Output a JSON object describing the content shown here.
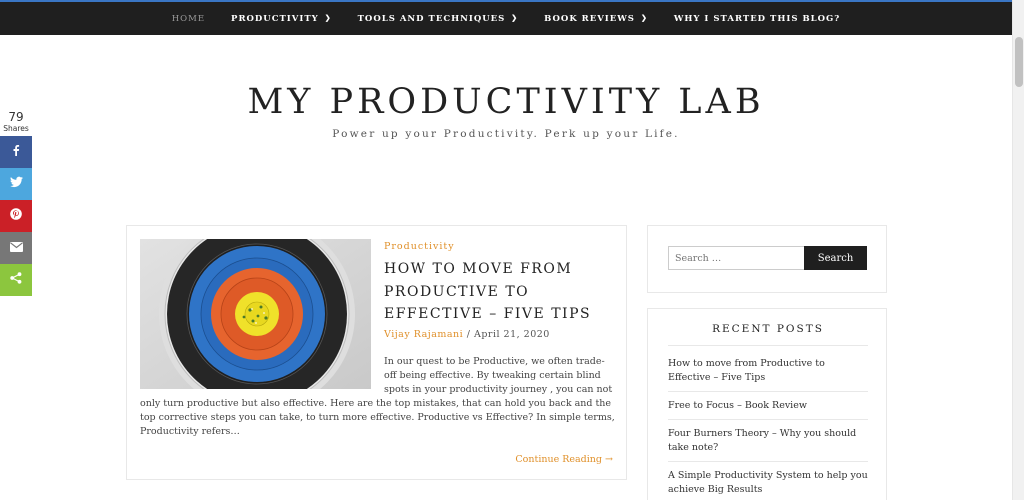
{
  "nav": {
    "items": [
      {
        "label": "HOME",
        "dropdown": false
      },
      {
        "label": "PRODUCTIVITY",
        "dropdown": true
      },
      {
        "label": "TOOLS AND TECHNIQUES",
        "dropdown": true
      },
      {
        "label": "BOOK REVIEWS",
        "dropdown": true
      },
      {
        "label": "WHY I STARTED THIS BLOG?",
        "dropdown": false
      }
    ]
  },
  "header": {
    "title": "MY PRODUCTIVITY LAB",
    "tagline": "Power up your Productivity. Perk up your Life."
  },
  "share": {
    "count": "79",
    "count_label": "Shares",
    "buttons": [
      {
        "name": "facebook",
        "glyph": "f",
        "color": "#3b5998"
      },
      {
        "name": "twitter",
        "glyph": "t",
        "color": "#4da7de"
      },
      {
        "name": "pinterest",
        "glyph": "P",
        "color": "#cb2027"
      },
      {
        "name": "email",
        "glyph": "✉",
        "color": "#777777"
      },
      {
        "name": "sharethis",
        "glyph": "<",
        "color": "#8cc63e"
      }
    ]
  },
  "post": {
    "category": "Productivity",
    "title": "HOW TO MOVE FROM PRODUCTIVE TO EFFECTIVE – FIVE TIPS",
    "author": "Vijay Rajamani",
    "separator": "/",
    "date": "April 21, 2020",
    "excerpt": "In our quest to be Productive, we often trade-off being effective. By tweaking certain blind spots in your productivity journey , you can not only turn productive but also effective. Here are the top mistakes, that can hold you back and the top corrective steps you can take, to turn more effective. Productive vs Effective? In simple terms, Productivity refers…",
    "read_more": "Continue Reading →"
  },
  "sidebar": {
    "search": {
      "placeholder": "Search …",
      "button": "Search"
    },
    "recent": {
      "title": "RECENT POSTS",
      "items": [
        "How to move from Productive to Effective – Five Tips",
        "Free to Focus – Book Review",
        "Four Burners Theory – Why you should take note?",
        "A Simple Productivity System to help you achieve Big Results"
      ]
    }
  },
  "colors": {
    "accent": "#e0902a",
    "nav_bg": "#1f1f1f",
    "nav_border": "#3a76c4"
  }
}
